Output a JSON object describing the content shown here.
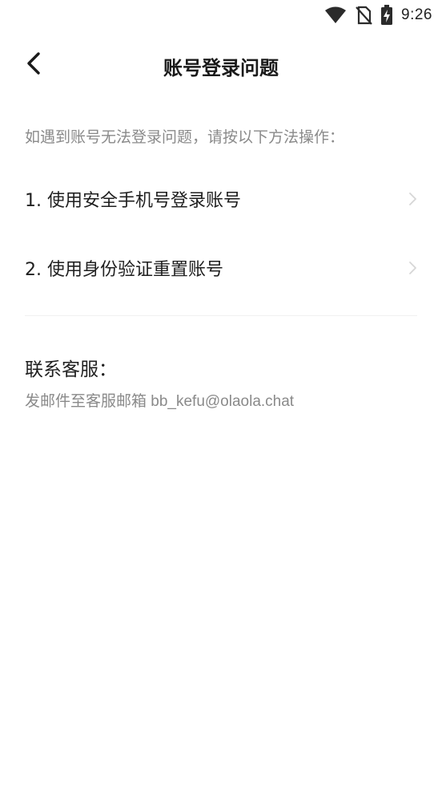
{
  "status_bar": {
    "time": "9:26",
    "icons": [
      "wifi-icon",
      "no-sim-icon",
      "battery-charging-icon"
    ]
  },
  "header": {
    "title": "账号登录问题",
    "back_icon": "chevron-left-icon"
  },
  "intro_text": "如遇到账号无法登录问题，请按以下方法操作：",
  "options": [
    {
      "label": "1. 使用安全手机号登录账号",
      "icon": "chevron-right-icon"
    },
    {
      "label": "2. 使用身份验证重置账号",
      "icon": "chevron-right-icon"
    }
  ],
  "contact": {
    "title": "联系客服：",
    "text": "发邮件至客服邮箱 bb_kefu@olaola.chat"
  }
}
